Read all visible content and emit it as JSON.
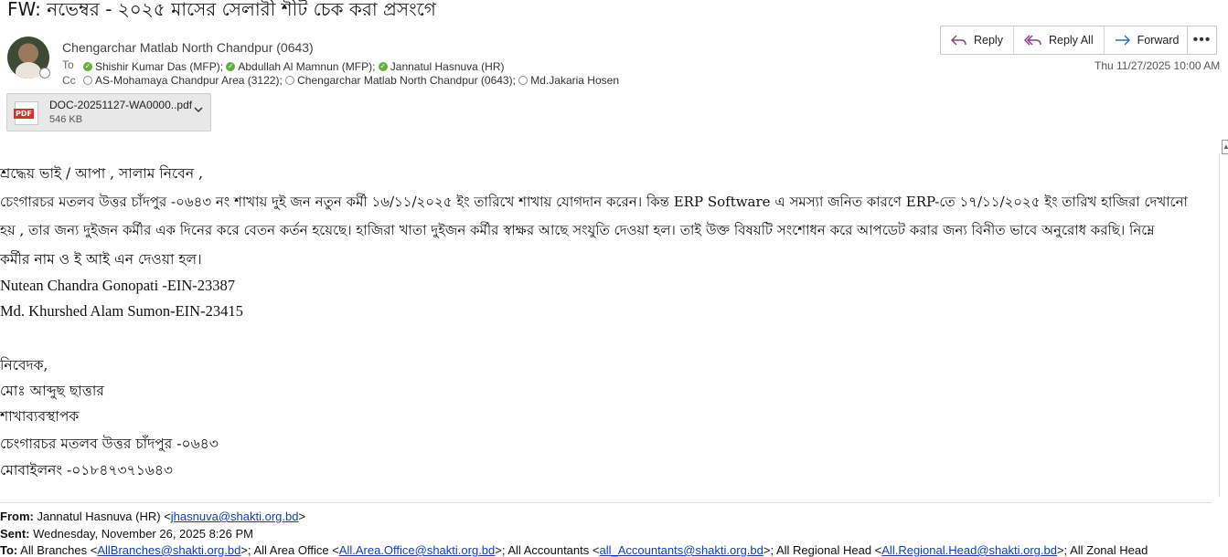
{
  "subject": "FW: নভেম্বর - ২০২৫ মাসের সেলারী শীট চেক করা প্রসংগে",
  "sender": "Chengarchar Matlab North Chandpur (0643)",
  "to_label": "To",
  "cc_label": "Cc",
  "to": [
    "Shishir Kumar Das (MFP);",
    "Abdullah Al Mamnun (MFP);",
    "Jannatul Hasnuva (HR)"
  ],
  "cc": [
    "AS-Mohamaya Chandpur Area (3122);",
    "Chengarchar Matlab North Chandpur (0643);",
    "Md.Jakaria Hosen"
  ],
  "actions": {
    "reply": "Reply",
    "reply_all": "Reply All",
    "forward": "Forward",
    "more": "•••"
  },
  "date": "Thu 11/27/2025 10:00 AM",
  "attachment": {
    "name": "DOC-20251127-WA0000..pdf",
    "size": "546 KB",
    "badge": "PDF"
  },
  "body": {
    "greeting": "শ্রদ্ধেয়  ভাই / আপা , সালাম নিবেন ,",
    "line1": "চেংগারচর মতলব উত্তর চাঁদপুর -০৬৪৩ নং শাখায়  দুই জন নতুন কর্মী  ১৬/১১/২০২৫ ইং তারিখে  শাখায় যোগদান করেন। কিন্ত  ERP  Software এ সমস্যা জনিত কারণে  ERP-তে  ১৭/১১/২০২৫ ইং তারিখ হাজিরা দেখানো",
    "line2": "হয় , তার জন্য দুইজন কর্মীর  এক দিনের করে বেতন কর্তন হয়েছে। হাজিরা খাতা দুইজন কর্মীর  স্বাক্ষর আছে  সংযুতি  দেওয়া হল। তাই উক্ত বিষয়টি সংশোধন করে আপডেট করার জন্য বিনীত ভাবে অনুরোধ করছি। নিম্নে",
    "line3": "কর্মীর নাম ও ই আই এন  দেওয়া হল।",
    "emp1": "Nutean Chandra Gonopati -EIN-23387",
    "emp2": "Md. Khurshed Alam Sumon-EIN-23415",
    "sig1": "নিবেদক,",
    "sig2": "মোঃ আব্দুছ ছাত্তার",
    "sig3": "শাখাব্যবস্থাপক",
    "sig4": "চেংগারচর মতলব উত্তর চাঁদপুর -০৬৪৩",
    "sig5": "মোবাইলনং -০১৮৪৭৩৭১৬৪৩"
  },
  "fwd": {
    "from_label": "From:",
    "from_name": "Jannatul Hasnuva (HR) <",
    "from_email": "jhasnuva@shakti.org.bd",
    "from_end": ">",
    "sent_label": "Sent:",
    "sent_value": "Wednesday, November 26, 2025 8:26 PM",
    "to_label": "To:",
    "to_value_a": "All Branches <",
    "to_link_a": "AllBranches@shakti.org.bd",
    "to_value_b": ">; All Area Office <",
    "to_link_b": "All.Area.Office@shakti.org.bd",
    "to_value_c": ">; All Accountants <",
    "to_link_c": "all_Accountants@shakti.org.bd",
    "to_value_d": ">; All Regional Head <",
    "to_link_d": "All.Regional.Head@shakti.org.bd",
    "to_value_e": ">; All Zonal Head"
  }
}
